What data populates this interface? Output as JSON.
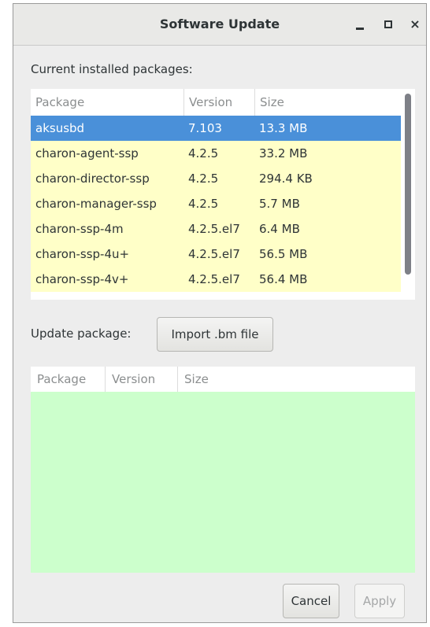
{
  "window": {
    "title": "Software Update"
  },
  "installed": {
    "label": "Current installed packages:",
    "columns": [
      "Package",
      "Version",
      "Size"
    ],
    "rows": [
      {
        "package": "aksusbd",
        "version": "7.103",
        "size": "13.3 MB"
      },
      {
        "package": "charon-agent-ssp",
        "version": "4.2.5",
        "size": "33.2 MB"
      },
      {
        "package": "charon-director-ssp",
        "version": "4.2.5",
        "size": "294.4 KB"
      },
      {
        "package": "charon-manager-ssp",
        "version": "4.2.5",
        "size": "5.7 MB"
      },
      {
        "package": "charon-ssp-4m",
        "version": "4.2.5.el7",
        "size": "6.4 MB"
      },
      {
        "package": "charon-ssp-4u+",
        "version": "4.2.5.el7",
        "size": "56.5 MB"
      },
      {
        "package": "charon-ssp-4v+",
        "version": "4.2.5.el7",
        "size": "56.4 MB"
      }
    ],
    "selected_row": 0
  },
  "update": {
    "label": "Update package:",
    "import_button": "Import .bm file",
    "columns": [
      "Package",
      "Version",
      "Size"
    ]
  },
  "footer": {
    "cancel": "Cancel",
    "apply": "Apply"
  },
  "colors": {
    "selection": "#4a90d9",
    "installed_row_bg": "#ffffc8",
    "update_list_bg": "#ccffcc"
  }
}
